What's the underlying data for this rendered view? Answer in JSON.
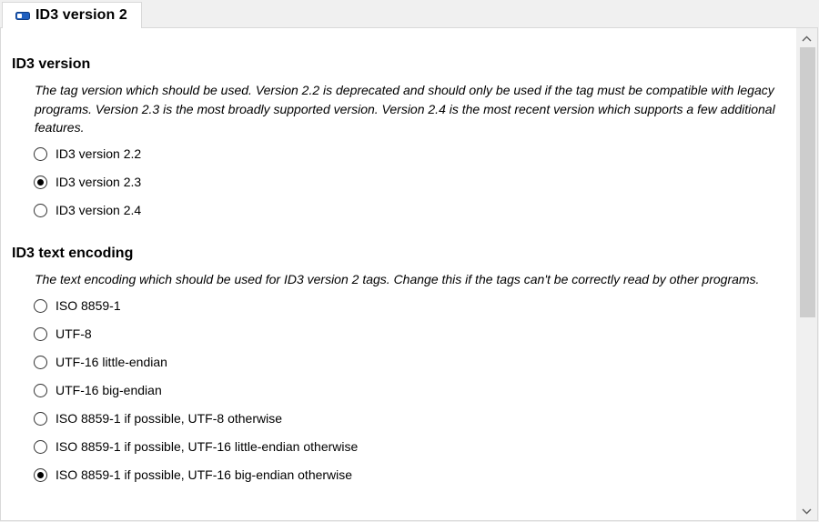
{
  "tab": {
    "label": "ID3 version 2",
    "icon": "tag-icon",
    "icon_color": "#1f5fbf"
  },
  "version": {
    "title": "ID3 version",
    "description": "The tag version which should be used. Version 2.2 is deprecated and should only be used if the tag must be compatible with legacy programs. Version 2.3 is the most broadly supported version. Version 2.4 is the most recent version which supports a few additional features.",
    "options": [
      {
        "label": "ID3 version 2.2",
        "checked": false
      },
      {
        "label": "ID3 version 2.3",
        "checked": true
      },
      {
        "label": "ID3 version 2.4",
        "checked": false
      }
    ]
  },
  "encoding": {
    "title": "ID3 text encoding",
    "description": "The text encoding which should be used for ID3 version 2 tags. Change this if the tags can't be correctly read by other programs.",
    "options": [
      {
        "label": "ISO 8859-1",
        "checked": false
      },
      {
        "label": "UTF-8",
        "checked": false
      },
      {
        "label": "UTF-16 little-endian",
        "checked": false
      },
      {
        "label": "UTF-16 big-endian",
        "checked": false
      },
      {
        "label": "ISO 8859-1 if possible, UTF-8 otherwise",
        "checked": false
      },
      {
        "label": "ISO 8859-1 if possible, UTF-16 little-endian otherwise",
        "checked": false
      },
      {
        "label": "ISO 8859-1 if possible, UTF-16 big-endian otherwise",
        "checked": true
      }
    ]
  },
  "scrollbar": {
    "up_icon": "chevron-up-icon",
    "down_icon": "chevron-down-icon"
  }
}
